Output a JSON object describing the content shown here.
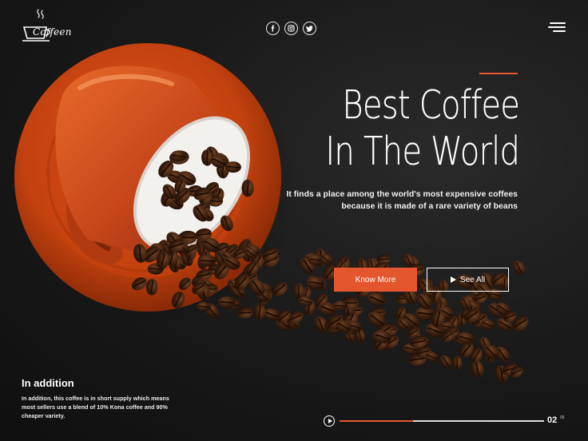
{
  "brand": {
    "name": "Coffeen"
  },
  "social": {
    "icons": [
      "facebook-icon",
      "instagram-icon",
      "twitter-icon"
    ]
  },
  "hero": {
    "title_line1": "Best Coffee",
    "title_line2": "In The World",
    "subtitle": "It finds a place among the world's most expensive coffees because it is made of a rare variety of beans",
    "primary_button": "Know More",
    "secondary_button": "See All"
  },
  "info": {
    "title": "In addition",
    "text": "In addition, this coffee is in short supply which means most sellers use a blend of 10% Kona coffee and 90% cheaper variety."
  },
  "slider": {
    "current": "02",
    "total": "05",
    "progress": 0.36
  },
  "colors": {
    "accent": "#e4572e",
    "background": "#141414",
    "text": "#ffffff"
  }
}
